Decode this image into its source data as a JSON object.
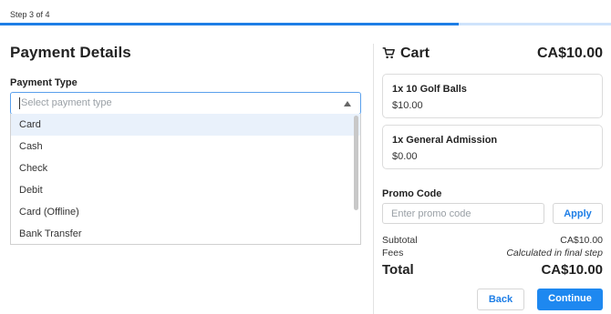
{
  "progress": {
    "step_text": "Step 3 of 4",
    "fraction": 0.75,
    "fill_color": "#1e7ee6",
    "track_color": "#cfe3fb"
  },
  "payment": {
    "title": "Payment Details",
    "type_label": "Payment Type",
    "select_placeholder": "Select payment type",
    "options": [
      "Card",
      "Cash",
      "Check",
      "Debit",
      "Card (Offline)",
      "Bank Transfer"
    ],
    "highlighted_option": "Card"
  },
  "cart": {
    "title": "Cart",
    "icon": "cart-icon",
    "total": "CA$10.00",
    "items": [
      {
        "name": "1x 10 Golf Balls",
        "price": "$10.00"
      },
      {
        "name": "1x General Admission",
        "price": "$0.00"
      }
    ],
    "promo_label": "Promo Code",
    "promo_placeholder": "Enter promo code",
    "apply_label": "Apply",
    "subtotal_label": "Subtotal",
    "subtotal_value": "CA$10.00",
    "fees_label": "Fees",
    "fees_value": "Calculated in final step",
    "total_label": "Total",
    "total_value": "CA$10.00",
    "back_label": "Back",
    "continue_label": "Continue",
    "accent_color": "#1e88f0"
  }
}
